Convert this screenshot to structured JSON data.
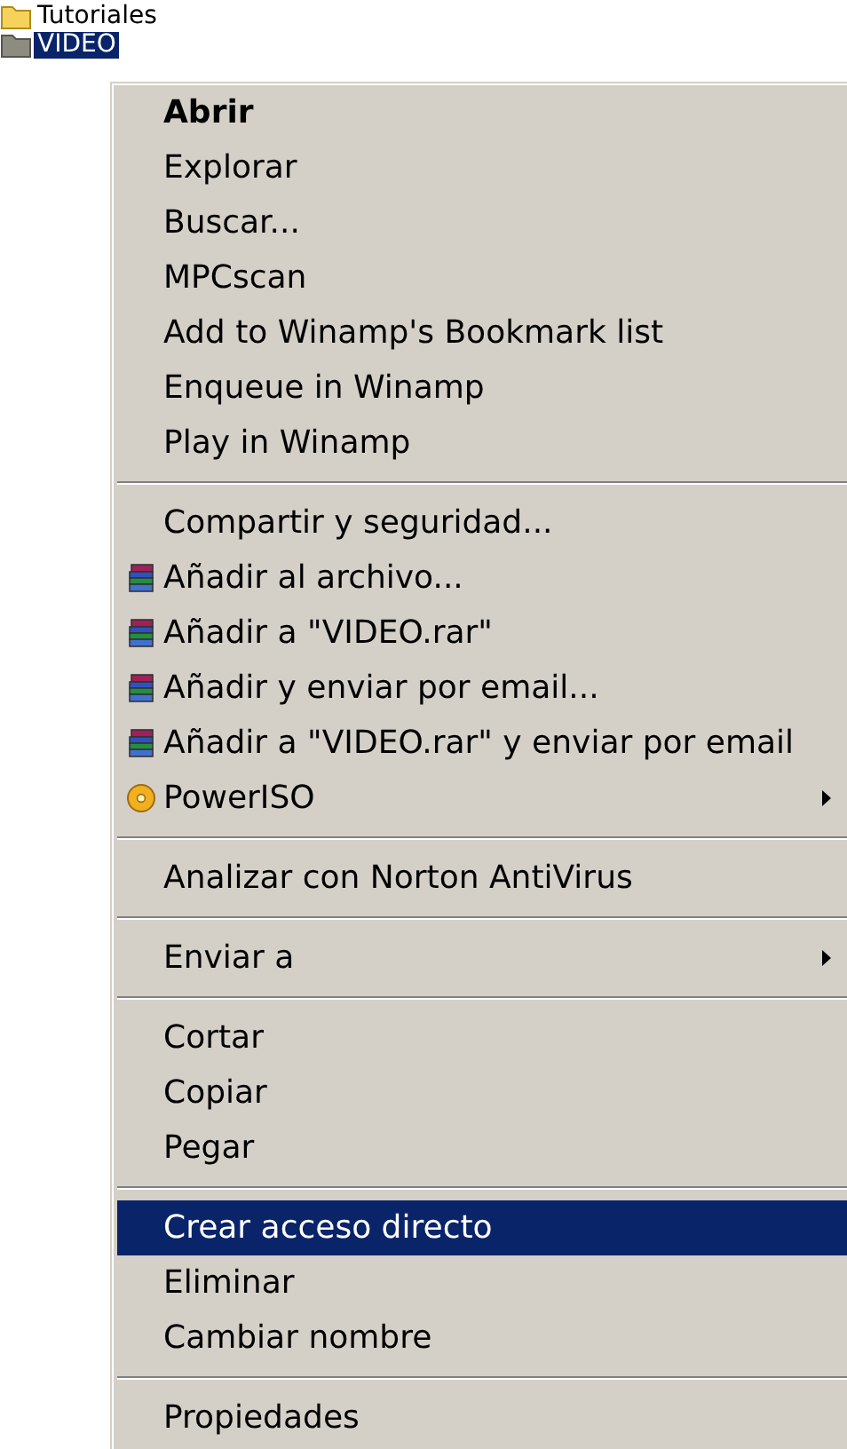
{
  "tree": [
    {
      "label": "Tutoriales",
      "selected": false
    },
    {
      "label": "VIDEO",
      "selected": true
    }
  ],
  "context_menu": [
    {
      "kind": "item",
      "label": "Abrir",
      "bold": true,
      "selected": false
    },
    {
      "kind": "item",
      "label": "Explorar",
      "selected": false
    },
    {
      "kind": "item",
      "label": "Buscar...",
      "selected": false
    },
    {
      "kind": "item",
      "label": "MPCscan",
      "selected": false
    },
    {
      "kind": "item",
      "label": "Add to Winamp's Bookmark list",
      "selected": false
    },
    {
      "kind": "item",
      "label": "Enqueue in Winamp",
      "selected": false
    },
    {
      "kind": "item",
      "label": "Play in Winamp",
      "selected": false
    },
    {
      "kind": "separator"
    },
    {
      "kind": "item",
      "label": "Compartir y seguridad...",
      "selected": false
    },
    {
      "kind": "archive",
      "label": "Añadir al archivo...",
      "selected": false
    },
    {
      "kind": "archive",
      "label": "Añadir a \"VIDEO.rar\"",
      "selected": false
    },
    {
      "kind": "archive",
      "label": "Añadir y enviar por email...",
      "selected": false
    },
    {
      "kind": "archive",
      "label": "Añadir a \"VIDEO.rar\" y enviar por email",
      "selected": false
    },
    {
      "kind": "disc",
      "label": "PowerISO",
      "submenu": true,
      "selected": false
    },
    {
      "kind": "separator"
    },
    {
      "kind": "item",
      "label": "Analizar con Norton AntiVirus",
      "selected": false
    },
    {
      "kind": "separator"
    },
    {
      "kind": "item",
      "label": "Enviar a",
      "submenu": true,
      "selected": false
    },
    {
      "kind": "separator"
    },
    {
      "kind": "item",
      "label": "Cortar",
      "selected": false
    },
    {
      "kind": "item",
      "label": "Copiar",
      "selected": false
    },
    {
      "kind": "item",
      "label": "Pegar",
      "selected": false
    },
    {
      "kind": "separator"
    },
    {
      "kind": "item",
      "label": "Crear acceso directo",
      "selected": true
    },
    {
      "kind": "item",
      "label": "Eliminar",
      "selected": false
    },
    {
      "kind": "item",
      "label": "Cambiar nombre",
      "selected": false
    },
    {
      "kind": "separator"
    },
    {
      "kind": "item",
      "label": "Propiedades",
      "selected": false
    }
  ]
}
